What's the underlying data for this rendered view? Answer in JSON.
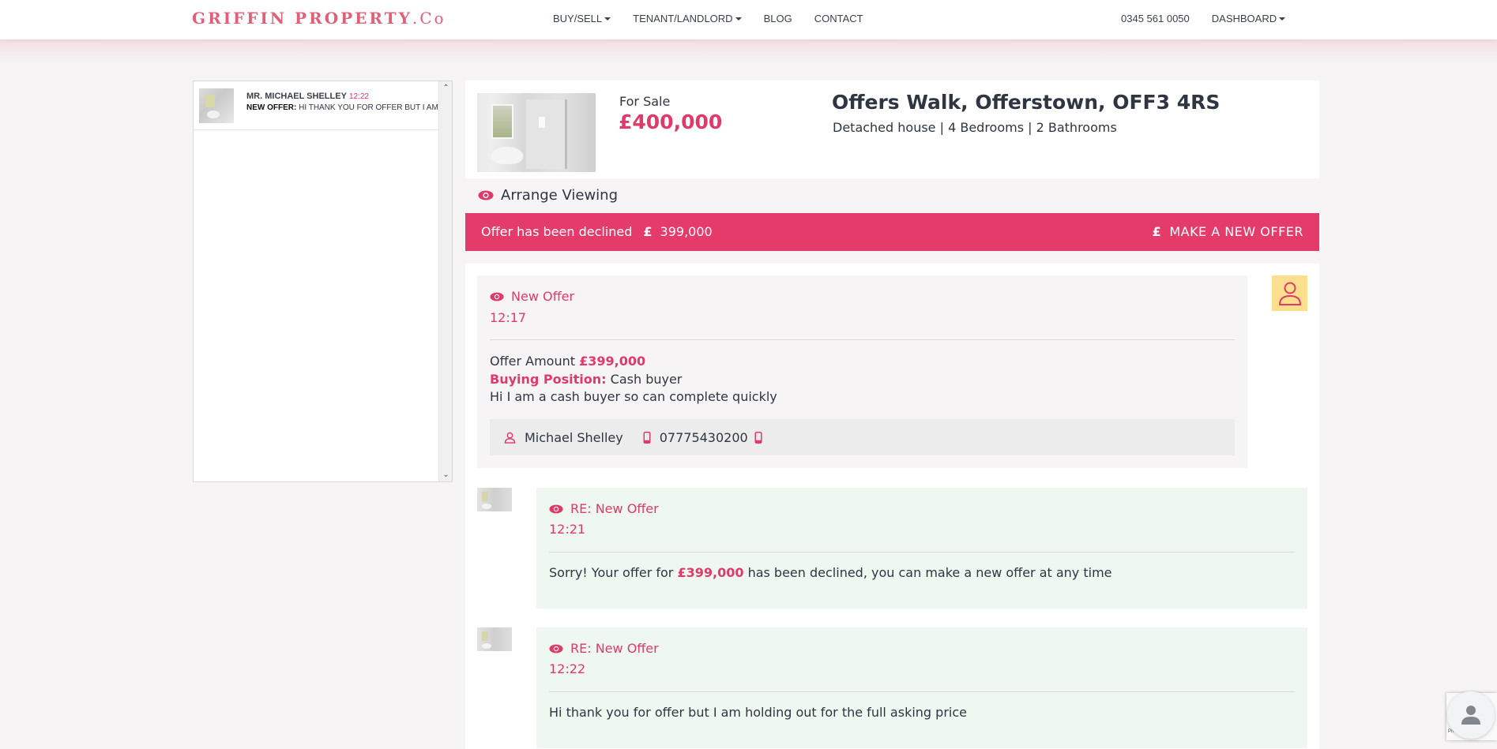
{
  "navbar": {
    "brand": "GRIFFIN PROPERTY",
    "brand_suffix": ".Co",
    "links": [
      {
        "label": "BUY/SELL",
        "dropdown": true
      },
      {
        "label": "TENANT/LANDLORD",
        "dropdown": true
      },
      {
        "label": "BLOG",
        "dropdown": false
      },
      {
        "label": "CONTACT",
        "dropdown": false
      }
    ],
    "phone": "0345 561 0050",
    "dashboard": "DASHBOARD"
  },
  "conversations": [
    {
      "name": "MR. MICHAEL SHELLEY",
      "time": "12:22",
      "snippet_label": "NEW OFFER:",
      "snippet": "HI THANK YOU FOR OFFER BUT I AM HOLDING OUT FOR THE FULL ASKING PRICE"
    }
  ],
  "property": {
    "status": "For Sale",
    "price": "£400,000",
    "address": "Offers Walk, Offerstown, OFF3 4RS",
    "details": "Detached house | 4 Bedrooms | 2 Bathrooms"
  },
  "arrange_viewing": "Arrange Viewing",
  "decline_banner": {
    "text": "Offer has been declined",
    "currency": "£",
    "amount": "399,000",
    "button_currency": "£",
    "button_label": "MAKE A NEW OFFER"
  },
  "offer_message": {
    "title": "New Offer",
    "time": "12:17",
    "amount_label": "Offer Amount",
    "amount": "£399,000",
    "position_label": "Buying Position:",
    "position": "Cash buyer",
    "message": "Hi I am a cash buyer so can complete quickly",
    "contact_name": "Michael Shelley",
    "contact_phone": "07775430200"
  },
  "replies": [
    {
      "title": "RE: New Offer",
      "time": "12:21",
      "text_before": "Sorry! Your offer for",
      "amount": "£399,000",
      "text_after": "has been declined, you can make a new offer at any time"
    },
    {
      "title": "RE: New Offer",
      "time": "12:22",
      "text": "Hi thank you for offer but I am holding out for the full asking price"
    }
  ],
  "recaptcha": {
    "text": "Privacy - Terms"
  },
  "colors": {
    "accent": "#e53b6b",
    "brand": "#e0607a",
    "reply_bg": "#eff7f1",
    "avatar_bg": "#fcdf8d"
  }
}
